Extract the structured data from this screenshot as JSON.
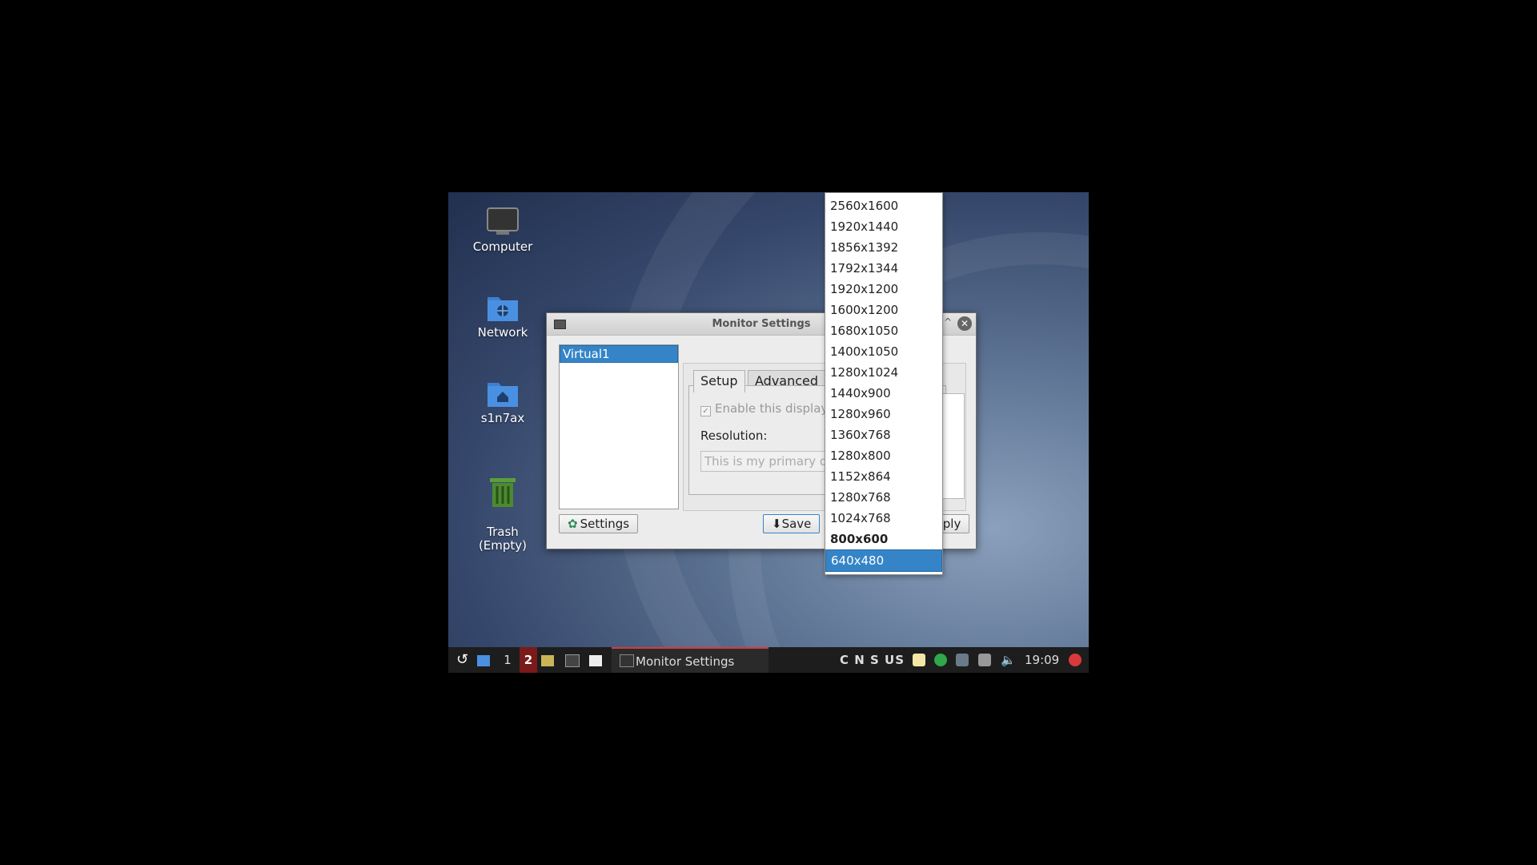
{
  "desktop": {
    "icons": [
      {
        "label": "Computer"
      },
      {
        "label": "Network"
      },
      {
        "label": "s1n7ax"
      },
      {
        "label": "Trash\n(Empty)"
      }
    ]
  },
  "dialog": {
    "title": "Monitor Settings",
    "outputs": [
      "Virtual1"
    ],
    "tabs": [
      "Setup",
      "Advanced"
    ],
    "enable_label": "Enable this display",
    "resolution_label": "Resolution:",
    "primary_placeholder": "This is my primary display",
    "buttons": {
      "settings": "Settings",
      "save": "Save",
      "apply": "Apply"
    }
  },
  "resolution_dropdown": {
    "options": [
      "2560x1600",
      "1920x1440",
      "1856x1392",
      "1792x1344",
      "1920x1200",
      "1600x1200",
      "1680x1050",
      "1400x1050",
      "1280x1024",
      "1440x900",
      "1280x960",
      "1360x768",
      "1280x800",
      "1152x864",
      "1280x768",
      "1024x768",
      "800x600",
      "640x480"
    ],
    "current": "800x600",
    "highlighted": "640x480"
  },
  "taskbar": {
    "workspaces": [
      "1",
      "2"
    ],
    "active_workspace": "2",
    "task_label": "Monitor Settings",
    "keyboard_indicator": "C N S US",
    "clock": "19:09"
  },
  "colors": {
    "accent": "#3584c8",
    "task_underline": "#d83a3a",
    "workspace_active": "#7a1a1a"
  }
}
